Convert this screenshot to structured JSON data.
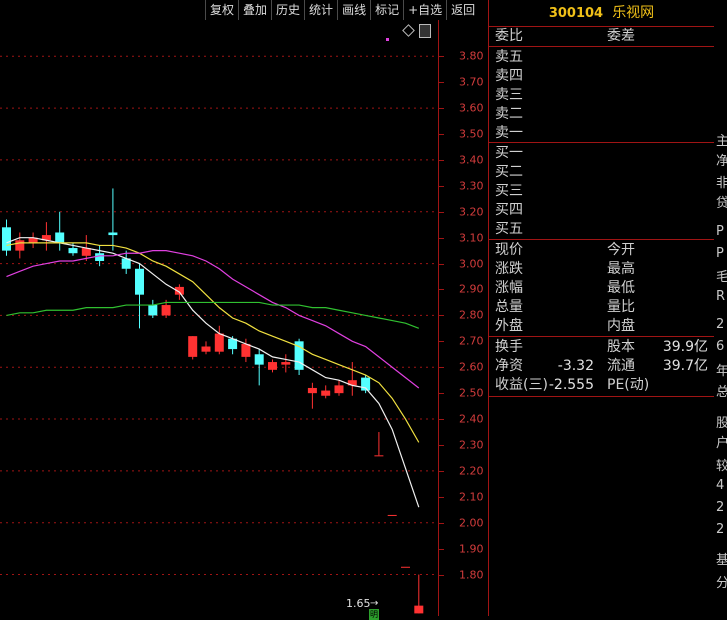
{
  "toolbar": {
    "buttons": [
      "复权",
      "叠加",
      "历史",
      "统计",
      "画线",
      "标记",
      "+自选",
      "返回"
    ]
  },
  "stock": {
    "code": "300104",
    "name": "乐视网"
  },
  "quote_panel": {
    "header": {
      "ratio_label": "委比",
      "diff_label": "委差"
    },
    "sell_levels": [
      "卖五",
      "卖四",
      "卖三",
      "卖二",
      "卖一"
    ],
    "buy_levels": [
      "买一",
      "买二",
      "买三",
      "买四",
      "买五"
    ],
    "stats": [
      {
        "left": "现价",
        "right": "今开"
      },
      {
        "left": "涨跌",
        "right": "最高"
      },
      {
        "left": "涨幅",
        "right": "最低"
      },
      {
        "left": "总量",
        "right": "量比"
      },
      {
        "left": "外盘",
        "right": "内盘"
      }
    ],
    "fundamentals": [
      {
        "left": "换手",
        "left_value": "",
        "right": "股本",
        "right_value": "39.9亿"
      },
      {
        "left": "净资",
        "left_value": "-3.32",
        "right": "流通",
        "right_value": "39.7亿"
      },
      {
        "left": "收益(三)",
        "left_value": "-2.555",
        "right": "PE(动)",
        "right_value": ""
      }
    ]
  },
  "right_edge_chars": [
    "主",
    "净",
    "非",
    "贷",
    "P",
    "P",
    "毛",
    "R",
    "2",
    "6",
    "年",
    "总",
    "股",
    "户",
    "较",
    "4",
    "2",
    "2",
    "基",
    "分"
  ],
  "low_price_label": "1.65",
  "low_badge": "明",
  "colors": {
    "up": "#ff3232",
    "down": "#54ffff",
    "grid": "#a01414",
    "ma5": "#f0f0f0",
    "ma10": "#f0e040",
    "ma20": "#e040e0",
    "ma60": "#30c030"
  },
  "chart_data": {
    "type": "candlestick",
    "y_ticks": [
      "3.80",
      "3.70",
      "3.60",
      "3.50",
      "3.40",
      "3.30",
      "3.20",
      "3.10",
      "3.00",
      "2.90",
      "2.80",
      "2.70",
      "2.60",
      "2.50",
      "2.40",
      "2.30",
      "2.20",
      "2.10",
      "2.00",
      "1.90",
      "1.80"
    ],
    "ylim": [
      1.64,
      3.94
    ],
    "candles": [
      {
        "open": 3.14,
        "close": 3.05,
        "high": 3.17,
        "low": 3.03
      },
      {
        "open": 3.05,
        "close": 3.09,
        "high": 3.12,
        "low": 3.02
      },
      {
        "open": 3.08,
        "close": 3.1,
        "high": 3.12,
        "low": 3.06
      },
      {
        "open": 3.09,
        "close": 3.11,
        "high": 3.16,
        "low": 3.05
      },
      {
        "open": 3.12,
        "close": 3.08,
        "high": 3.2,
        "low": 3.05
      },
      {
        "open": 3.06,
        "close": 3.04,
        "high": 3.08,
        "low": 3.03
      },
      {
        "open": 3.03,
        "close": 3.06,
        "high": 3.11,
        "low": 3.01
      },
      {
        "open": 3.04,
        "close": 3.01,
        "high": 3.07,
        "low": 2.99
      },
      {
        "open": 3.12,
        "close": 3.11,
        "high": 3.29,
        "low": 3.05
      },
      {
        "open": 3.02,
        "close": 2.98,
        "high": 3.05,
        "low": 2.96
      },
      {
        "open": 2.98,
        "close": 2.88,
        "high": 3.0,
        "low": 2.75
      },
      {
        "open": 2.84,
        "close": 2.8,
        "high": 2.86,
        "low": 2.79
      },
      {
        "open": 2.8,
        "close": 2.84,
        "high": 2.86,
        "low": 2.79
      },
      {
        "open": 2.88,
        "close": 2.91,
        "high": 2.92,
        "low": 2.86
      },
      {
        "open": 2.64,
        "close": 2.72,
        "high": 2.72,
        "low": 2.63
      },
      {
        "open": 2.66,
        "close": 2.68,
        "high": 2.7,
        "low": 2.65
      },
      {
        "open": 2.66,
        "close": 2.73,
        "high": 2.76,
        "low": 2.65
      },
      {
        "open": 2.71,
        "close": 2.67,
        "high": 2.72,
        "low": 2.65
      },
      {
        "open": 2.64,
        "close": 2.69,
        "high": 2.71,
        "low": 2.62
      },
      {
        "open": 2.65,
        "close": 2.61,
        "high": 2.67,
        "low": 2.53
      },
      {
        "open": 2.59,
        "close": 2.62,
        "high": 2.63,
        "low": 2.58
      },
      {
        "open": 2.61,
        "close": 2.62,
        "high": 2.65,
        "low": 2.58
      },
      {
        "open": 2.7,
        "close": 2.59,
        "high": 2.71,
        "low": 2.57
      },
      {
        "open": 2.5,
        "close": 2.52,
        "high": 2.54,
        "low": 2.44
      },
      {
        "open": 2.49,
        "close": 2.51,
        "high": 2.53,
        "low": 2.48
      },
      {
        "open": 2.5,
        "close": 2.53,
        "high": 2.55,
        "low": 2.49
      },
      {
        "open": 2.53,
        "close": 2.55,
        "high": 2.62,
        "low": 2.49
      },
      {
        "open": 2.56,
        "close": 2.51,
        "high": 2.57,
        "low": 2.5
      },
      {
        "open": 2.26,
        "close": 2.26,
        "high": 2.35,
        "low": 2.26
      },
      {
        "open": 2.03,
        "close": 2.03,
        "high": 2.03,
        "low": 2.03
      },
      {
        "open": 1.83,
        "close": 1.83,
        "high": 1.83,
        "low": 1.83
      },
      {
        "open": 1.65,
        "close": 1.68,
        "high": 1.8,
        "low": 1.65
      }
    ],
    "series": [
      {
        "key": "ma5",
        "values": [
          3.08,
          3.1,
          3.1,
          3.09,
          3.08,
          3.07,
          3.06,
          3.05,
          3.04,
          3.02,
          3.0,
          2.96,
          2.92,
          2.89,
          2.82,
          2.77,
          2.73,
          2.71,
          2.69,
          2.67,
          2.64,
          2.63,
          2.62,
          2.59,
          2.56,
          2.55,
          2.53,
          2.52,
          2.46,
          2.36,
          2.21,
          2.06
        ]
      },
      {
        "key": "ma10",
        "values": [
          3.07,
          3.08,
          3.08,
          3.08,
          3.08,
          3.08,
          3.08,
          3.07,
          3.07,
          3.06,
          3.04,
          3.01,
          2.99,
          2.96,
          2.93,
          2.88,
          2.83,
          2.79,
          2.77,
          2.74,
          2.72,
          2.7,
          2.68,
          2.65,
          2.63,
          2.61,
          2.59,
          2.57,
          2.54,
          2.48,
          2.4,
          2.31
        ]
      },
      {
        "key": "ma20",
        "values": [
          2.95,
          2.97,
          2.99,
          3.0,
          3.01,
          3.01,
          3.02,
          3.03,
          3.03,
          3.04,
          3.04,
          3.05,
          3.05,
          3.04,
          3.03,
          3.01,
          2.98,
          2.94,
          2.91,
          2.88,
          2.85,
          2.83,
          2.8,
          2.78,
          2.76,
          2.73,
          2.7,
          2.68,
          2.64,
          2.6,
          2.56,
          2.52
        ]
      },
      {
        "key": "ma60",
        "values": [
          2.8,
          2.81,
          2.81,
          2.82,
          2.82,
          2.82,
          2.83,
          2.83,
          2.83,
          2.84,
          2.84,
          2.84,
          2.85,
          2.85,
          2.85,
          2.85,
          2.85,
          2.85,
          2.85,
          2.85,
          2.84,
          2.84,
          2.84,
          2.83,
          2.83,
          2.82,
          2.81,
          2.8,
          2.79,
          2.78,
          2.77,
          2.75
        ]
      }
    ]
  }
}
